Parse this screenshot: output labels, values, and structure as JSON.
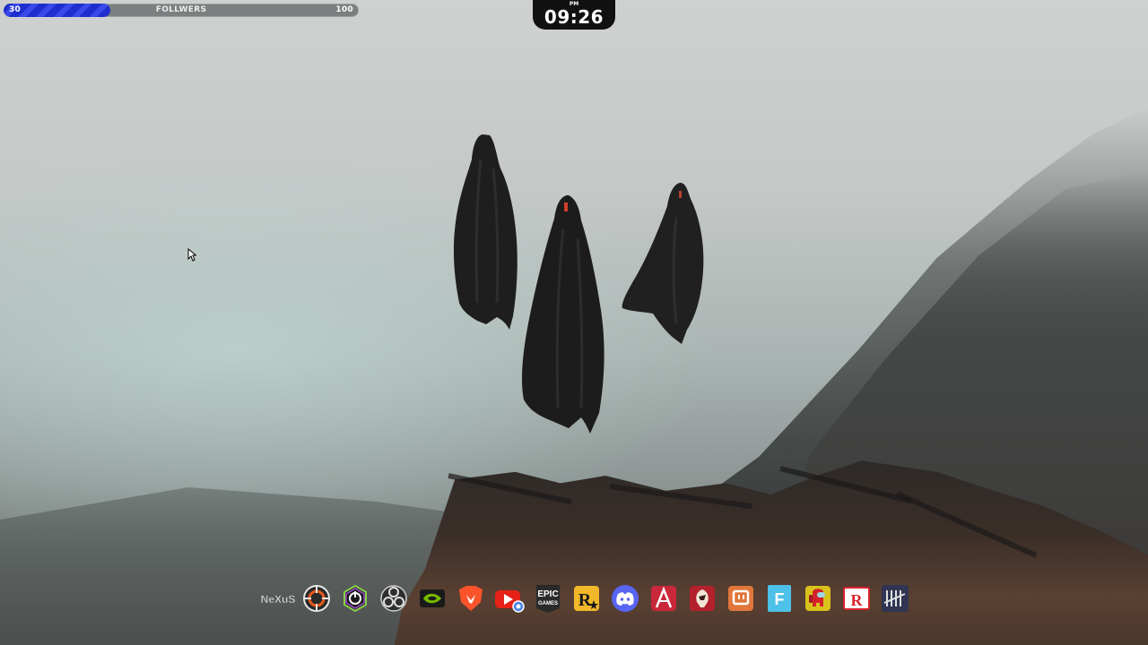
{
  "follower_goal": {
    "current": "30",
    "label": "FOLLWERS",
    "target": "100",
    "progress_fraction": 0.3,
    "fill_color": "#2334d6"
  },
  "clock": {
    "ampm": "PM",
    "time": "09:26"
  },
  "dock": {
    "items": [
      {
        "name": "nexus-icon",
        "text": "NeXuS"
      },
      {
        "name": "crosshair-app-icon"
      },
      {
        "name": "corsair-icue-icon"
      },
      {
        "name": "obs-studio-icon"
      },
      {
        "name": "nvidia-icon"
      },
      {
        "name": "brave-browser-icon"
      },
      {
        "name": "youtube-chrome-icon"
      },
      {
        "name": "epic-games-icon",
        "text_top": "EPIC",
        "text_bottom": "GAMES"
      },
      {
        "name": "rockstar-games-icon",
        "text": "R"
      },
      {
        "name": "discord-icon"
      },
      {
        "name": "affinity-icon"
      },
      {
        "name": "valorant-agent-icon"
      },
      {
        "name": "twitch-tracker-icon"
      },
      {
        "name": "fortnite-icon",
        "text": "F"
      },
      {
        "name": "among-us-icon"
      },
      {
        "name": "roblox-icon",
        "text": "R"
      },
      {
        "name": "dead-by-daylight-icon"
      }
    ]
  },
  "colors": {
    "accent_blue": "#2334d6",
    "clock_bg": "#111111"
  }
}
